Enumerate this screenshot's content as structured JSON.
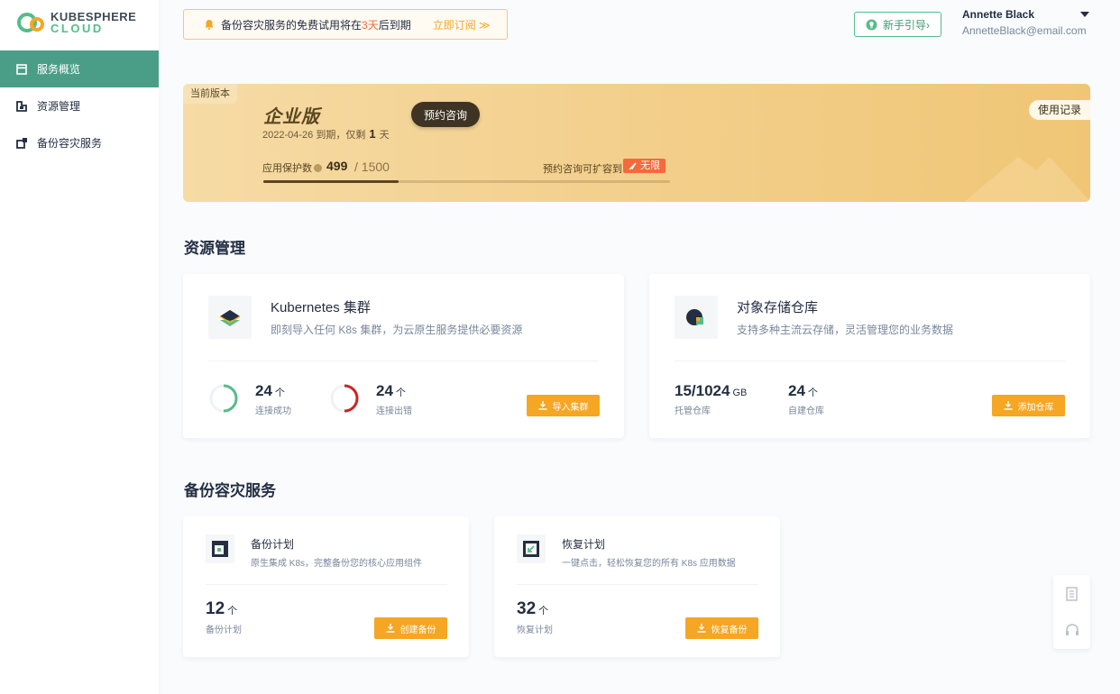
{
  "brand": {
    "line1": "KUBESPHERE",
    "line2": "CLOUD"
  },
  "sidebar": {
    "items": [
      {
        "label": "服务概览",
        "active": true
      },
      {
        "label": "资源管理",
        "active": false
      },
      {
        "label": "备份容灾服务",
        "active": false
      }
    ]
  },
  "notice": {
    "prefix": "备份容灾服务的免费试用将在",
    "days": "3天",
    "suffix": "后到期",
    "action": "立即订阅 ≫"
  },
  "guide": {
    "label": "新手引导›"
  },
  "user": {
    "name": "Annette Black",
    "email": "AnnetteBlack@email.com"
  },
  "plan": {
    "badge": "当前版本",
    "edition": "企业版",
    "consult": "预约咨询",
    "expire_date": "2022-04-26 到期，仅剩",
    "days_left": "1",
    "days_unit": "天",
    "quota_label": "应用保护数",
    "quota_used": "499",
    "quota_total": "/ 1500",
    "quota_fraction": 0.333,
    "expand_text": "预约咨询可扩容到",
    "unlimited": "无限",
    "history": "使用记录"
  },
  "resource": {
    "title": "资源管理",
    "k8s": {
      "title": "Kubernetes 集群",
      "desc": "即刻导入任何 K8s 集群，为云原生服务提供必要资源",
      "stat1": {
        "value": "24",
        "unit": "个",
        "label": "连接成功"
      },
      "stat2": {
        "value": "24",
        "unit": "个",
        "label": "连接出错"
      },
      "button": "导入集群"
    },
    "storage": {
      "title": "对象存储仓库",
      "desc": "支持多种主流云存储，灵活管理您的业务数据",
      "stat1": {
        "value": "15/1024",
        "unit": "GB",
        "label": "托管仓库"
      },
      "stat2": {
        "value": "24",
        "unit": "个",
        "label": "自建仓库"
      },
      "button": "添加仓库"
    }
  },
  "backup": {
    "title": "备份容灾服务",
    "plan": {
      "title": "备份计划",
      "desc": "原生集成 K8s，完整备份您的核心应用组件",
      "value": "12",
      "unit": "个",
      "label": "备份计划",
      "button": "创建备份"
    },
    "restore": {
      "title": "恢复计划",
      "desc": "一键点击，轻松恢复您的所有 K8s 应用数据",
      "value": "32",
      "unit": "个",
      "label": "恢复计划",
      "button": "恢复备份"
    }
  },
  "colors": {
    "accent": "#4a9e88",
    "orange": "#f5a623",
    "green": "#55bc8a",
    "red": "#ca2621"
  }
}
